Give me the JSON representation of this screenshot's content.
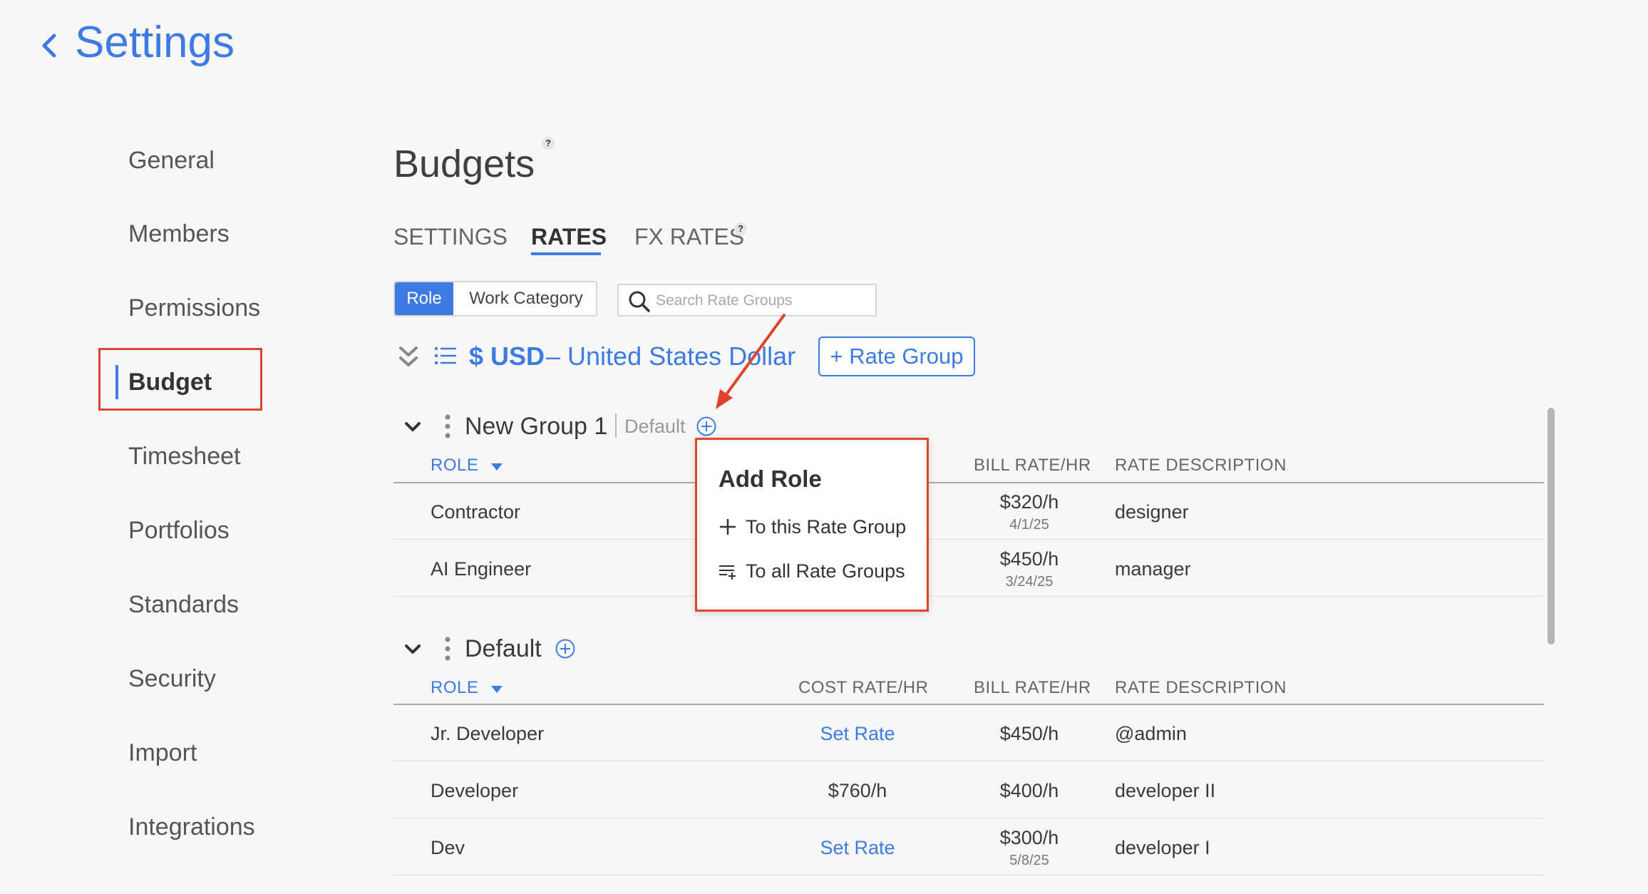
{
  "header": {
    "back_label": "Settings"
  },
  "sidebar": {
    "items": [
      {
        "label": "General"
      },
      {
        "label": "Members"
      },
      {
        "label": "Permissions"
      },
      {
        "label": "Budget",
        "active": true
      },
      {
        "label": "Timesheet"
      },
      {
        "label": "Portfolios"
      },
      {
        "label": "Standards"
      },
      {
        "label": "Security"
      },
      {
        "label": "Import"
      },
      {
        "label": "Integrations"
      }
    ]
  },
  "main": {
    "title": "Budgets",
    "help_mark": "?",
    "tabs": [
      {
        "label": "SETTINGS"
      },
      {
        "label": "RATES",
        "active": true
      },
      {
        "label": "FX RATES"
      }
    ],
    "toggle": {
      "role_label": "Role",
      "work_category_label": "Work Category",
      "selected": "Role"
    },
    "search": {
      "placeholder": "Search Rate Groups"
    },
    "currency": {
      "symbol": "$ USD",
      "name": "– United States Dollar",
      "add_rate_group_label": "+ Rate Group"
    }
  },
  "groups": [
    {
      "name": "New Group 1",
      "tag": "Default",
      "columns": {
        "role": "ROLE",
        "bill": "BILL RATE/HR",
        "desc": "RATE DESCRIPTION"
      },
      "rows": [
        {
          "role": "Contractor",
          "bill": "$320/h",
          "bill_date": "4/1/25",
          "desc": "designer"
        },
        {
          "role": "AI Engineer",
          "bill": "$450/h",
          "bill_date": "3/24/25",
          "desc": "manager"
        }
      ]
    },
    {
      "name": "Default",
      "columns": {
        "role": "ROLE",
        "cost": "COST RATE/HR",
        "bill": "BILL RATE/HR",
        "desc": "RATE DESCRIPTION"
      },
      "rows": [
        {
          "role": "Jr. Developer",
          "cost": "Set Rate",
          "bill": "$450/h",
          "desc": "@admin"
        },
        {
          "role": "Developer",
          "cost": "$760/h",
          "bill": "$400/h",
          "desc": "developer II"
        },
        {
          "role": "Dev",
          "cost": "Set Rate",
          "bill": "$300/h",
          "bill_date": "5/8/25",
          "desc": "developer I"
        }
      ]
    }
  ],
  "popup": {
    "title": "Add Role",
    "items": [
      {
        "label": "To this Rate Group",
        "icon": "plus-icon"
      },
      {
        "label": "To all Rate Groups",
        "icon": "list-add-icon"
      }
    ]
  },
  "colors": {
    "accent": "#3d7be3",
    "highlight": "#e0432d",
    "background": "#f7f7f7"
  }
}
